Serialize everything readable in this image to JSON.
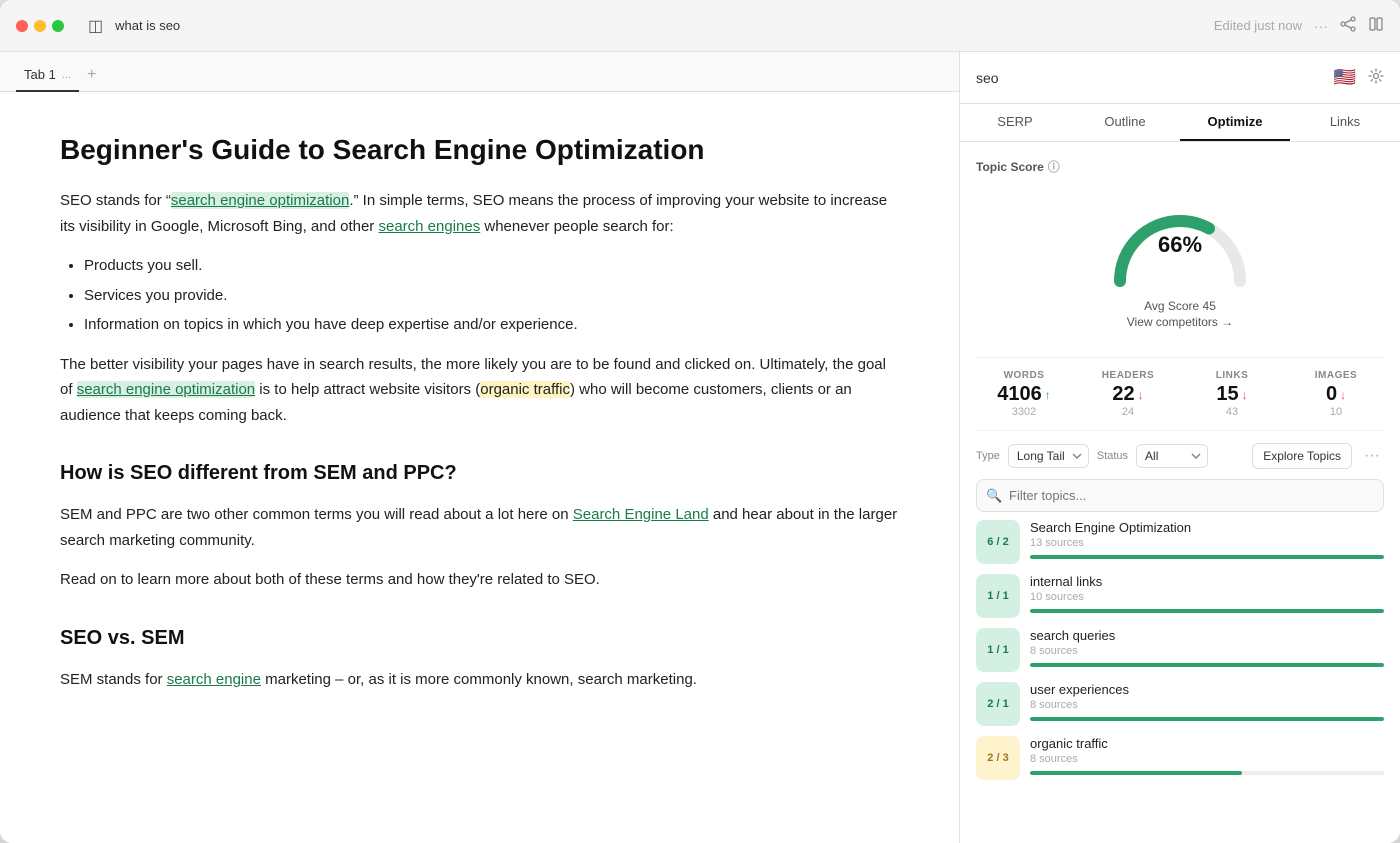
{
  "window": {
    "title": "what is seo"
  },
  "titlebar": {
    "sidebar_icon": "⊞",
    "title": "what is seo",
    "edited_label": "Edited just now",
    "share_icon": "share",
    "layout_icon": "layout"
  },
  "tabs": {
    "tab1_label": "Tab 1",
    "tab1_dots": "...",
    "add_label": "+"
  },
  "editor": {
    "h1": "Beginner's Guide to Search Engine Optimization",
    "p1_before": "SEO stands for “",
    "p1_link1": "search engine optimization",
    "p1_mid": ".” In simple terms, SEO means the process of improving your website to increase its visibility in Google, Microsoft Bing, and other ",
    "p1_link2": "search engines",
    "p1_after": " whenever people search for:",
    "bullet1": "Products you sell.",
    "bullet2": "Services you provide.",
    "bullet3": "Information on topics in which you have deep expertise and/or experience.",
    "p2_before": "The better visibility your pages have in search results, the more likely you are to be found and clicked on. Ultimately, the goal of ",
    "p2_link": "search engine optimization",
    "p2_mid": " is to help attract website visitors (",
    "p2_highlight": "organic traffic",
    "p2_after": ") who will become customers, clients or an audience that keeps coming back.",
    "h2_1": "How is SEO different from SEM and PPC?",
    "p3_before": "SEM and PPC are two other common terms you will read about a lot here on ",
    "p3_link": "Search Engine Land",
    "p3_after": " and hear about in the larger search marketing community.",
    "p4": "Read on to learn more about both of these terms and how they're related to SEO.",
    "h2_2": "SEO vs. SEM",
    "p5_before": "SEM stands for ",
    "p5_link": "search engine",
    "p5_after": " marketing – or, as it is more commonly known, search marketing."
  },
  "right_panel": {
    "search_value": "seo",
    "flag": "🇺🇸",
    "tabs": [
      "SERP",
      "Outline",
      "Optimize",
      "Links"
    ],
    "active_tab": "Optimize",
    "topic_score_label": "Topic Score",
    "gauge_percent": "66%",
    "avg_score_label": "Avg Score 45",
    "view_competitors": "View competitors →",
    "stats": [
      {
        "label": "WORDS",
        "value": "4106",
        "arrow": "up",
        "compare": "3302"
      },
      {
        "label": "HEADERS",
        "value": "22",
        "arrow": "down",
        "compare": "24"
      },
      {
        "label": "LINKS",
        "value": "15",
        "arrow": "down",
        "compare": "43"
      },
      {
        "label": "IMAGES",
        "value": "0",
        "arrow": "down",
        "compare": "10"
      }
    ],
    "type_label": "Type",
    "type_value": "Long Tail",
    "status_label": "Status",
    "status_value": "All",
    "explore_btn": "Explore Topics",
    "filter_placeholder": "Filter topics...",
    "topics": [
      {
        "badge": "6 / 2",
        "badge_type": "green",
        "name": "Search Engine Optimization",
        "sources": "13 sources",
        "bar": 100
      },
      {
        "badge": "1 / 1",
        "badge_type": "green",
        "name": "internal links",
        "sources": "10 sources",
        "bar": 100
      },
      {
        "badge": "1 / 1",
        "badge_type": "green",
        "name": "search queries",
        "sources": "8 sources",
        "bar": 100
      },
      {
        "badge": "2 / 1",
        "badge_type": "green",
        "name": "user experiences",
        "sources": "8 sources",
        "bar": 100
      },
      {
        "badge": "2 / 3",
        "badge_type": "yellow",
        "name": "organic traffic",
        "sources": "8 sources",
        "bar": 60
      }
    ]
  }
}
